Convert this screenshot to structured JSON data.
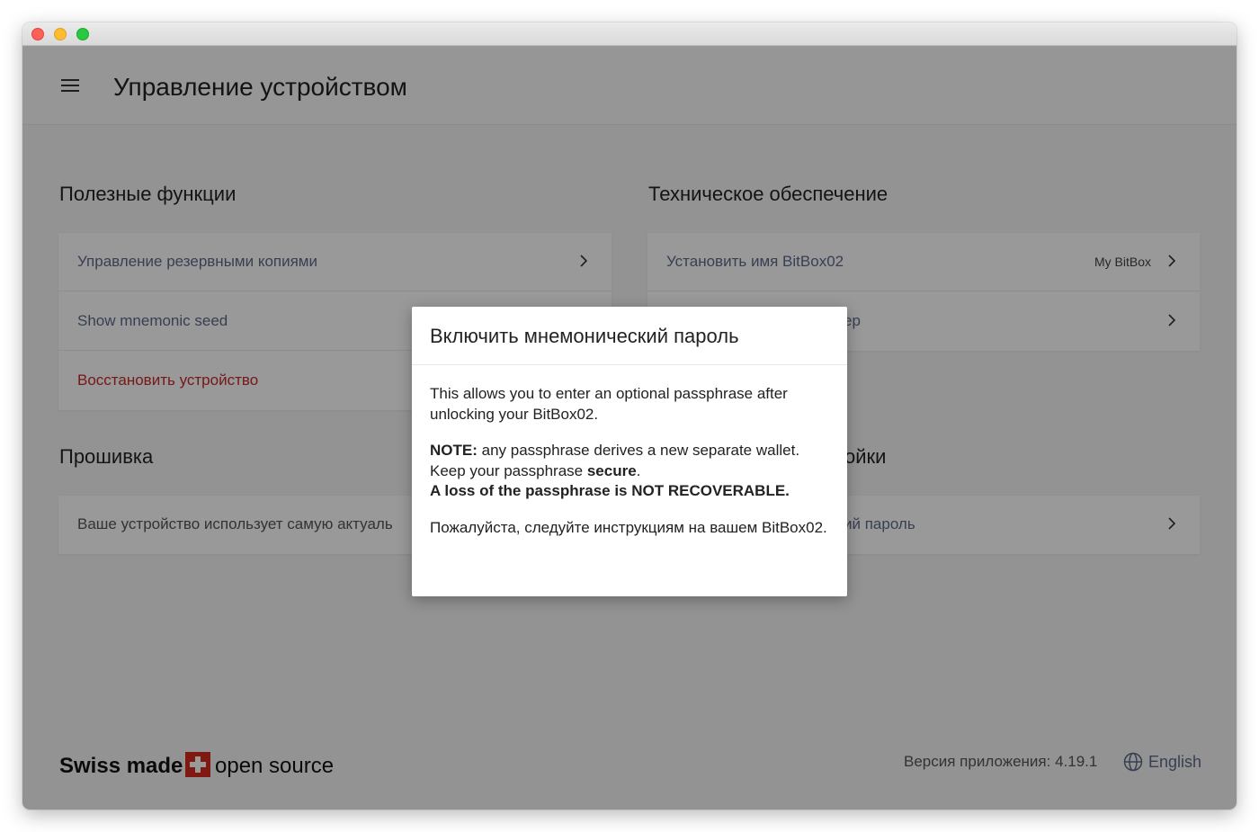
{
  "header": {
    "title": "Управление устройством"
  },
  "sections": {
    "useful": {
      "title": "Полезные функции",
      "items": [
        {
          "label": "Управление резервными копиями"
        },
        {
          "label": "Show mnemonic seed"
        },
        {
          "label": "Восстановить устройство"
        }
      ]
    },
    "hardware": {
      "title": "Техническое обеспечение",
      "items": [
        {
          "label": "Установить имя BitBox02",
          "value": "My BitBox"
        },
        {
          "label": "ер"
        }
      ]
    },
    "firmware": {
      "title": "Прошивка",
      "items": [
        {
          "label": "Ваше устройство использует самую актуаль"
        }
      ]
    },
    "settings": {
      "title": "ойки",
      "items": [
        {
          "label": "ий пароль"
        }
      ]
    }
  },
  "footer": {
    "brand_swiss": "Swiss made",
    "brand_open": "open source",
    "version": "Версия приложения: 4.19.1",
    "language": "English"
  },
  "modal": {
    "title": "Включить мнемонический пароль",
    "p1": "This allows you to enter an optional passphrase after unlocking your BitBox02.",
    "note_label": "NOTE:",
    "note_text": " any passphrase derives a new separate wallet.",
    "keep_text": "Keep your passphrase ",
    "secure": "secure",
    "period": ".",
    "warning": "A loss of the passphrase is NOT RECOVERABLE.",
    "p3": "Пожалуйста, следуйте инструкциям на вашем BitBox02."
  },
  "colors": {
    "accent": "#5c6b8a",
    "danger": "#c62828",
    "flag": "#d52b1e"
  }
}
